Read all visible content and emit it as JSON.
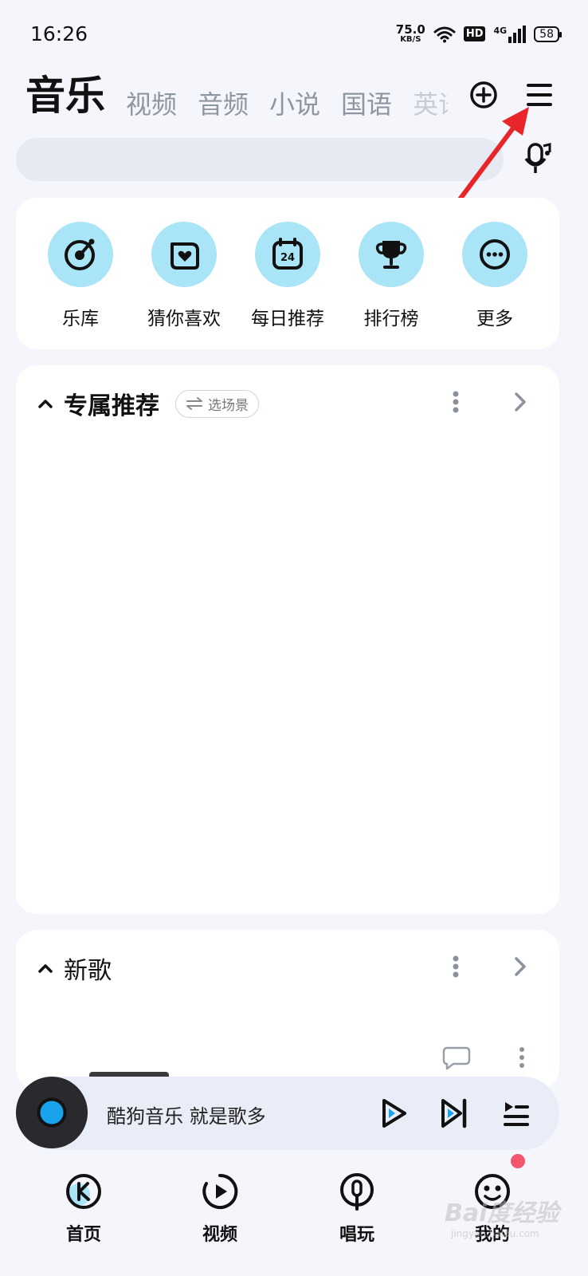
{
  "status_bar": {
    "time": "16:26",
    "net_speed_value": "75.0",
    "net_speed_unit": "KB/S",
    "hd_label": "HD",
    "network_type": "4G",
    "battery": "58"
  },
  "top_tabs": [
    {
      "label": "音乐",
      "active": true
    },
    {
      "label": "视频",
      "active": false
    },
    {
      "label": "音频",
      "active": false
    },
    {
      "label": "小说",
      "active": false
    },
    {
      "label": "国语",
      "active": false
    },
    {
      "label": "英语",
      "active": false
    }
  ],
  "header_icons": {
    "add": "plus-circle-icon",
    "menu": "hamburger-menu-icon",
    "mic": "mic-icon"
  },
  "search": {
    "placeholder": ""
  },
  "quick_menu": [
    {
      "label": "乐库",
      "icon": "music-disc-icon"
    },
    {
      "label": "猜你喜欢",
      "icon": "heart-box-icon"
    },
    {
      "label": "每日推荐",
      "icon": "calendar-24-icon"
    },
    {
      "label": "排行榜",
      "icon": "trophy-icon"
    },
    {
      "label": "更多",
      "icon": "more-dots-icon"
    }
  ],
  "sections": {
    "exclusive": {
      "title": "专属推荐",
      "scene_label": "选场景"
    },
    "new_songs": {
      "title": "新歌"
    }
  },
  "player": {
    "text": "酷狗音乐 就是歌多"
  },
  "bottom_nav": [
    {
      "label": "首页",
      "icon": "kugou-home-icon"
    },
    {
      "label": "视频",
      "icon": "video-play-icon"
    },
    {
      "label": "唱玩",
      "icon": "mic-sing-icon"
    },
    {
      "label": "我的",
      "icon": "smiley-profile-icon"
    }
  ],
  "watermark": {
    "text": "Bai度经验",
    "sub": "jingyan.baidu.com"
  },
  "colors": {
    "accent": "#1bb2ee",
    "icon_bg": "#a9e4f7",
    "annotation_arrow": "#e8262a",
    "badge": "#f2556e"
  }
}
